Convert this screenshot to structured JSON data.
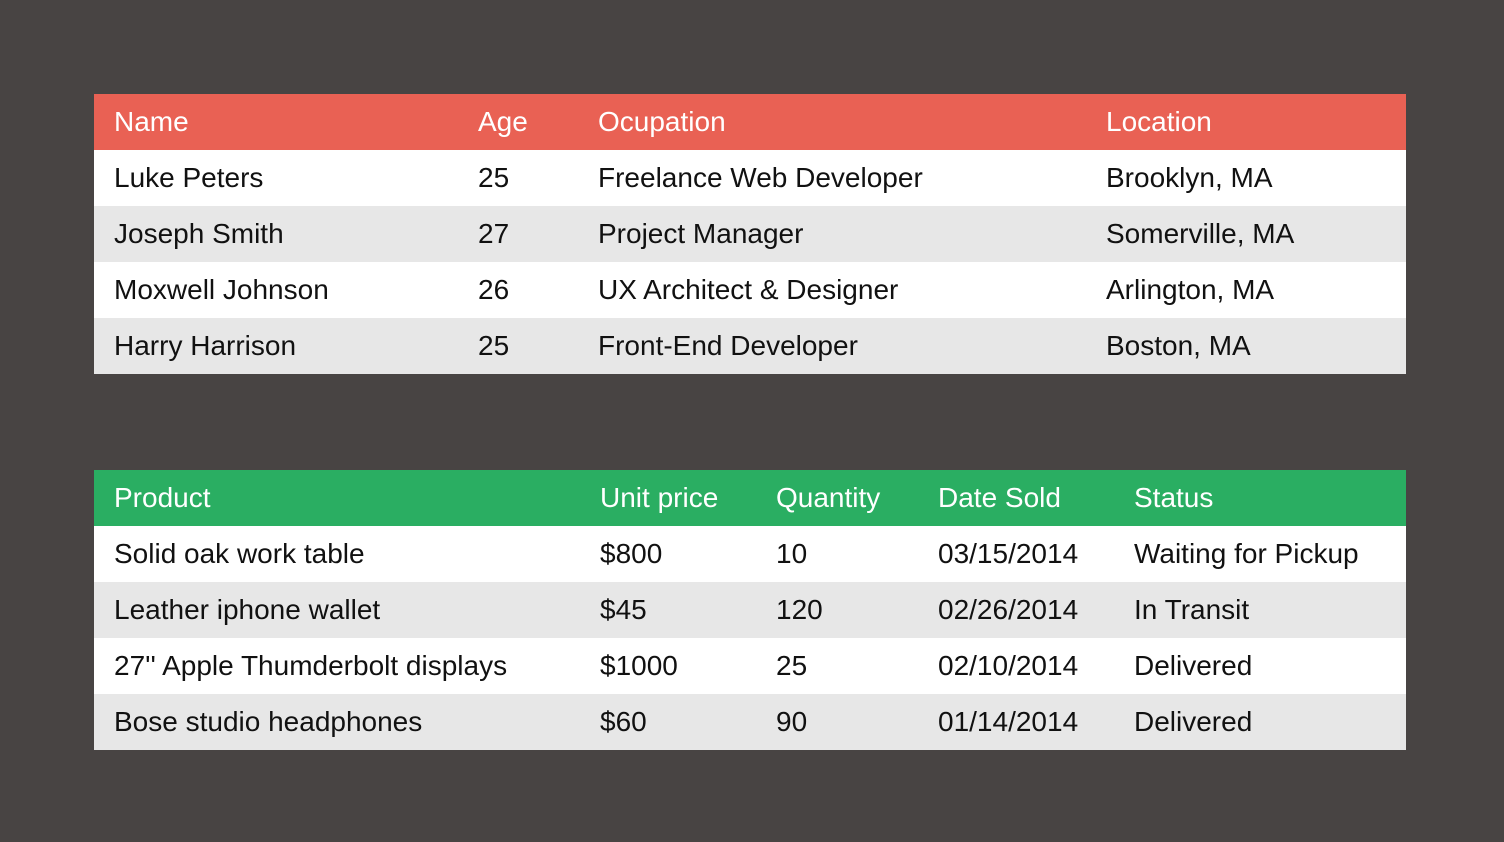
{
  "colors": {
    "background": "#484443",
    "people_header": "#e96154",
    "products_header": "#2aae62",
    "row_odd": "#ffffff",
    "row_even": "#e7e7e7"
  },
  "people_table": {
    "headers": [
      "Name",
      "Age",
      "Ocupation",
      "Location"
    ],
    "rows": [
      [
        "Luke Peters",
        "25",
        "Freelance Web Developer",
        "Brooklyn, MA"
      ],
      [
        "Joseph Smith",
        "27",
        "Project Manager",
        "Somerville, MA"
      ],
      [
        "Moxwell Johnson",
        "26",
        "UX Architect & Designer",
        "Arlington, MA"
      ],
      [
        "Harry Harrison",
        "25",
        "Front-End Developer",
        "Boston, MA"
      ]
    ]
  },
  "products_table": {
    "headers": [
      "Product",
      "Unit price",
      "Quantity",
      "Date Sold",
      "Status"
    ],
    "rows": [
      [
        "Solid oak work table",
        "$800",
        "10",
        "03/15/2014",
        "Waiting for Pickup"
      ],
      [
        "Leather iphone wallet",
        "$45",
        "120",
        "02/26/2014",
        "In Transit"
      ],
      [
        "27'' Apple Thumderbolt displays",
        "$1000",
        "25",
        "02/10/2014",
        "Delivered"
      ],
      [
        "Bose studio headphones",
        "$60",
        "90",
        "01/14/2014",
        "Delivered"
      ]
    ]
  }
}
